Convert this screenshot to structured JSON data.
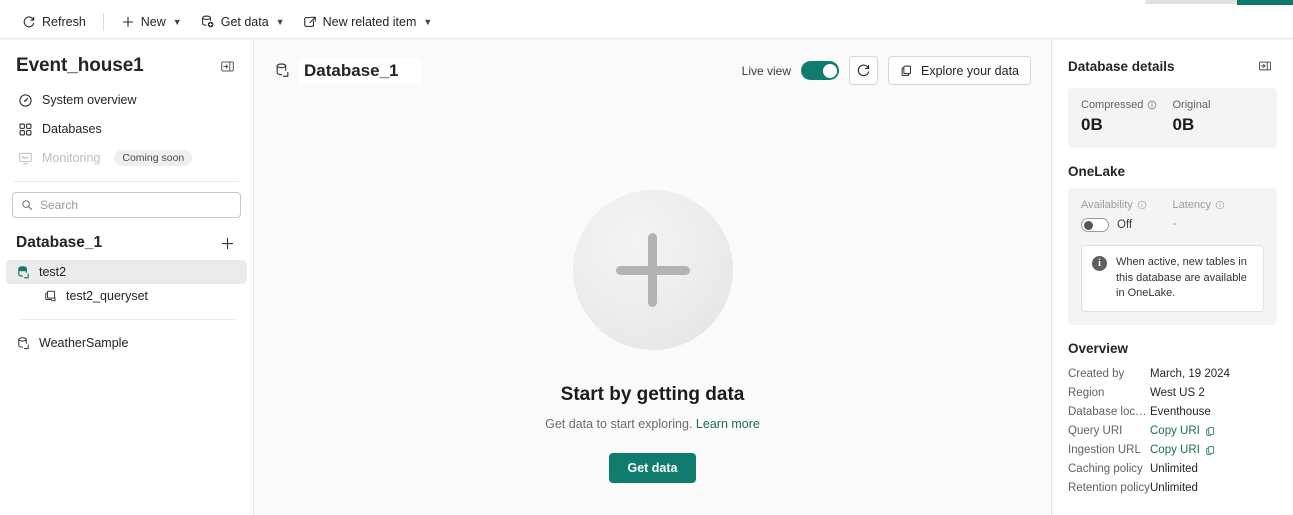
{
  "commandbar": {
    "items": [
      {
        "label": "Refresh",
        "icon": "refresh-icon",
        "caret": false
      },
      {
        "label": "New",
        "icon": "plus-icon",
        "caret": true
      },
      {
        "label": "Get data",
        "icon": "get-data-icon",
        "caret": true
      },
      {
        "label": "New related item",
        "icon": "external-link-icon",
        "caret": true
      }
    ]
  },
  "sidebar": {
    "eventhouse_name": "Event_house1",
    "collapse_icon": "collapse-panel-icon",
    "nav": [
      {
        "label": "System overview",
        "icon": "gauge-icon",
        "disabled": false,
        "badge": ""
      },
      {
        "label": "Databases",
        "icon": "grid-icon",
        "disabled": false,
        "badge": ""
      },
      {
        "label": "Monitoring",
        "icon": "monitor-icon",
        "disabled": true,
        "badge": "Coming soon"
      }
    ],
    "search": {
      "placeholder": "Search",
      "value": "",
      "icon": "search-icon"
    },
    "database_group_title": "Database_1",
    "add_icon": "plus-icon",
    "tree": [
      {
        "label": "test2",
        "icon": "database-icon",
        "level": 1,
        "selected": true
      },
      {
        "label": "test2_queryset",
        "icon": "queryset-icon",
        "level": 2,
        "selected": false
      }
    ],
    "tree_after_divider": [
      {
        "label": "WeatherSample",
        "icon": "database-icon",
        "level": 1,
        "selected": false
      }
    ]
  },
  "main": {
    "title": "Database_1",
    "title_icon": "database-icon",
    "live_view_label": "Live view",
    "live_view_on": true,
    "refresh_icon": "refresh-icon",
    "explore_button": {
      "label": "Explore your data",
      "icon": "explore-icon"
    },
    "empty_state": {
      "plus_icon": "plus-icon",
      "title": "Start by getting data",
      "subtitle": "Get data to start exploring.",
      "link": "Learn more",
      "button": "Get data"
    }
  },
  "right_panel": {
    "title": "Database details",
    "expand_icon": "expand-panel-icon",
    "stats": [
      {
        "label": "Compressed",
        "info": true,
        "value": "0B"
      },
      {
        "label": "Original",
        "info": false,
        "value": "0B"
      }
    ],
    "onelake": {
      "title": "OneLake",
      "availability_label": "Availability",
      "availability_value": "Off",
      "availability_on": false,
      "latency_label": "Latency",
      "latency_value": "-",
      "info_icon": "info-icon",
      "info_text": "When active, new tables in this database are available in OneLake."
    },
    "overview": {
      "title": "Overview",
      "rows": [
        {
          "key": "Created by",
          "value": "March, 19 2024",
          "type": "text"
        },
        {
          "key": "Region",
          "value": "West US 2",
          "type": "text"
        },
        {
          "key": "Database locati...",
          "value": "Eventhouse",
          "type": "text"
        },
        {
          "key": "Query URI",
          "value": "Copy URI",
          "type": "copy"
        },
        {
          "key": "Ingestion URL",
          "value": "Copy URI",
          "type": "copy"
        },
        {
          "key": "Caching policy",
          "value": "Unlimited",
          "type": "text"
        },
        {
          "key": "Retention policy",
          "value": "Unlimited",
          "type": "text"
        }
      ]
    }
  },
  "colors": {
    "accent": "#107c6e",
    "link": "#1a6b5e",
    "selected_row": "#ebebeb"
  }
}
